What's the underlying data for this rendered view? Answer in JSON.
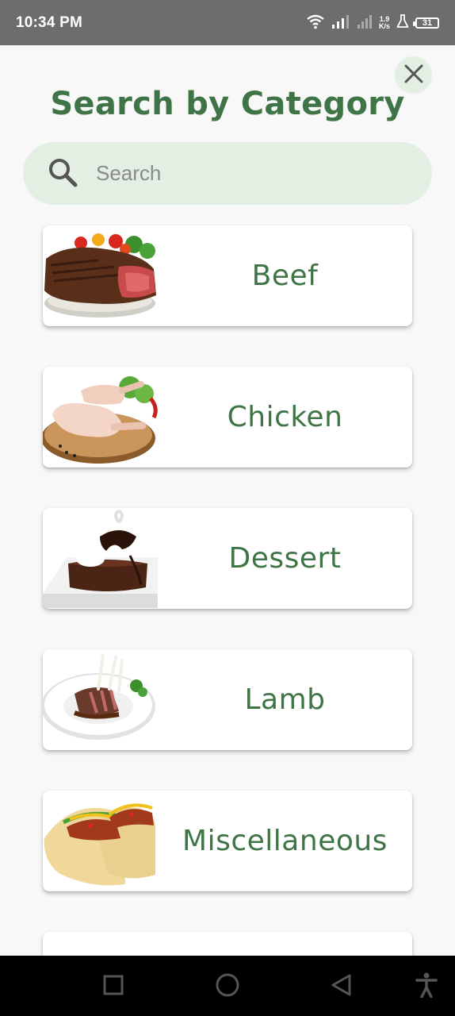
{
  "status_bar": {
    "time": "10:34 PM",
    "speed_value": "1.9",
    "speed_unit": "K/s",
    "battery": "31",
    "icons": [
      "wifi-icon",
      "signal-icon",
      "signal-icon",
      "lab-icon",
      "battery-icon"
    ]
  },
  "header": {
    "title": "Search by Category",
    "close_icon": "close-icon"
  },
  "search": {
    "placeholder": "Search",
    "value": "",
    "icon": "search-icon"
  },
  "categories": [
    {
      "label": "Beef",
      "image": "beef-steak-image"
    },
    {
      "label": "Chicken",
      "image": "chicken-legs-image"
    },
    {
      "label": "Dessert",
      "image": "chocolate-cake-image"
    },
    {
      "label": "Lamb",
      "image": "lamb-chops-image"
    },
    {
      "label": "Miscellaneous",
      "image": "tacos-image"
    }
  ],
  "nav_bar": {
    "icons": [
      "recents-square-icon",
      "home-circle-icon",
      "back-triangle-icon",
      "accessibility-icon"
    ]
  },
  "colors": {
    "accent_green": "#3f7446",
    "search_bg": "#e3efe3",
    "status_bar_bg": "#6d6d6d"
  }
}
